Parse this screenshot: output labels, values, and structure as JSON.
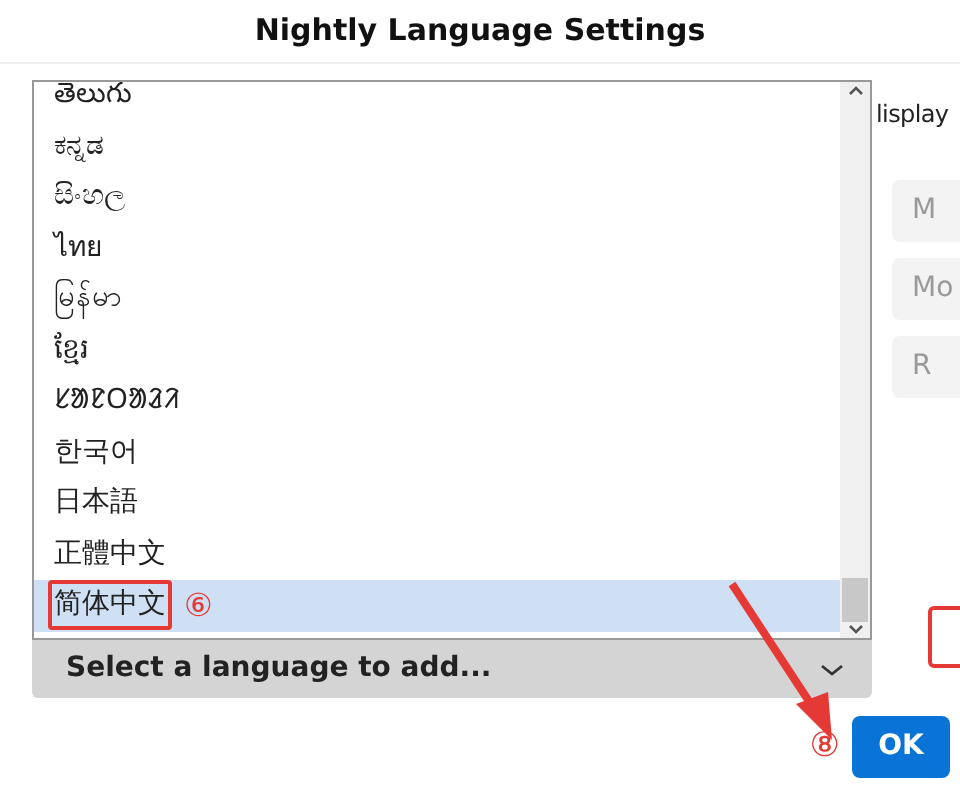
{
  "window": {
    "title": "Nightly Language Settings"
  },
  "languages": [
    {
      "label": "తెలుగు",
      "selected": false
    },
    {
      "label": "ಕನ್ನಡ",
      "selected": false
    },
    {
      "label": "සිංහල",
      "selected": false
    },
    {
      "label": "ไทย",
      "selected": false
    },
    {
      "label": "မြန်မာ",
      "selected": false
    },
    {
      "label": "ខ្មែរ",
      "selected": false
    },
    {
      "label": "ᱥᱟᱱᱛᱟᱲᱤ",
      "selected": false
    },
    {
      "label": "한국어",
      "selected": false
    },
    {
      "label": "日本語",
      "selected": false
    },
    {
      "label": "正體中文",
      "selected": false
    },
    {
      "label": "简体中文",
      "selected": true,
      "callout": "⑥"
    }
  ],
  "add_select": {
    "label": "Select a language to add..."
  },
  "side_text": "lisplay",
  "side_buttons": [
    "M",
    "Mo",
    "R"
  ],
  "ok_callout": "⑧",
  "ok_button": "OK"
}
